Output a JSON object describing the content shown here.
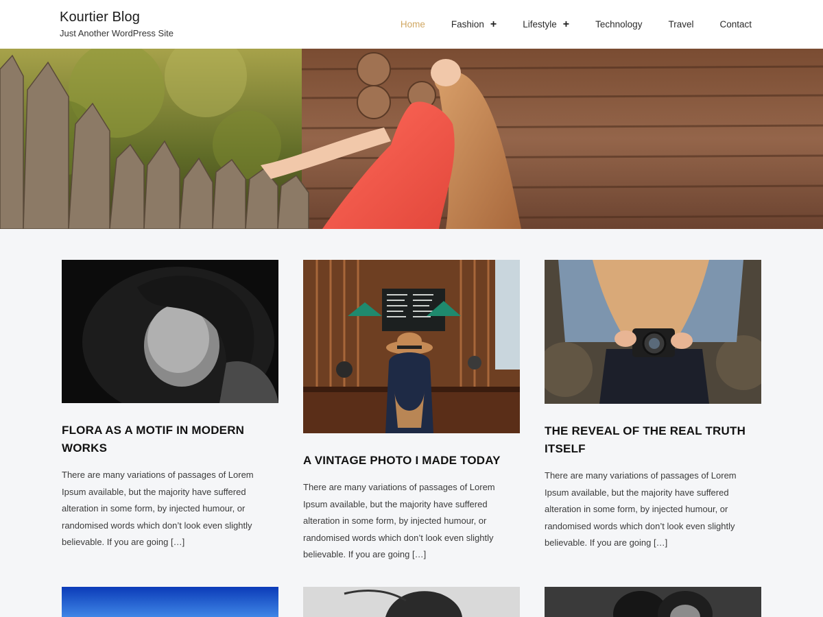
{
  "site": {
    "title": "Kourtier Blog",
    "tagline": "Just Another WordPress Site"
  },
  "nav": {
    "items": [
      {
        "label": "Home",
        "active": true,
        "has_submenu": false
      },
      {
        "label": "Fashion",
        "active": false,
        "has_submenu": true
      },
      {
        "label": "Lifestyle",
        "active": false,
        "has_submenu": true
      },
      {
        "label": "Technology",
        "active": false,
        "has_submenu": false
      },
      {
        "label": "Travel",
        "active": false,
        "has_submenu": false
      },
      {
        "label": "Contact",
        "active": false,
        "has_submenu": false
      }
    ],
    "submenu_icon": "+",
    "active_color": "#d0a762"
  },
  "posts": [
    {
      "title": "FLORA AS A MOTIF IN MODERN WORKS",
      "excerpt": "There are many variations of passages of Lorem Ipsum available, but the majority have suffered alteration in some form, by injected humour, or randomised words which don’t look even slightly believable. If you are going",
      "more": "[…]"
    },
    {
      "title": "A VINTAGE PHOTO I MADE TODAY",
      "excerpt": "There are many variations of passages of Lorem Ipsum available, but the majority have suffered alteration in some form, by injected humour, or randomised words which don’t look even slightly believable. If you are going",
      "more": "[…]"
    },
    {
      "title": "THE REVEAL OF THE REAL TRUTH ITSELF",
      "excerpt": "There are many variations of passages of Lorem Ipsum available, but the majority have suffered alteration in some form, by injected humour, or randomised words which don’t look even slightly believable. If you are going",
      "more": "[…]"
    }
  ]
}
